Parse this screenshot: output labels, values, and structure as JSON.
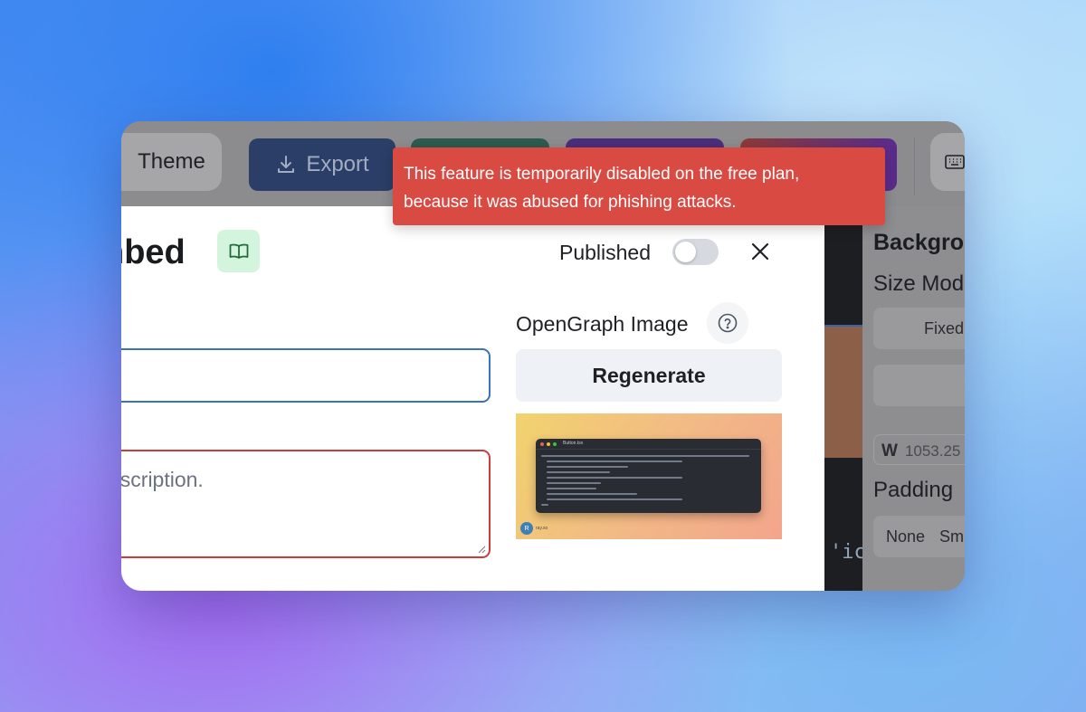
{
  "toolbar": {
    "theme_label": "Theme",
    "export_label": "Export"
  },
  "modal": {
    "title_partial": "nbed",
    "published_label": "Published",
    "published": false,
    "description_placeholder_partial": "escription.",
    "og_label": "OpenGraph Image",
    "regenerate_label": "Regenerate",
    "og_preview": {
      "tab_title": "Button.tsx",
      "avatar_initial": "R",
      "handle": "ray.so"
    }
  },
  "right_panel": {
    "title_partial": "Backgro",
    "size_mode_partial": "Size Mode",
    "fixed_label": "Fixed",
    "width_prefix": "W",
    "width_value_partial": "1053.25",
    "padding_label": "Padding",
    "padding_options": [
      "None",
      "Sm"
    ]
  },
  "code": {
    "visible_text": "'ic"
  },
  "tooltip": {
    "line1": "This feature is temporarily disabled on the free plan,",
    "line2": "because it was abused for phishing attacks."
  },
  "colors": {
    "tooltip_bg": "#d94a43",
    "input_focus": "#3b72ba",
    "input_error": "#cd3b3b",
    "book_badge": "#d4f5dd"
  }
}
